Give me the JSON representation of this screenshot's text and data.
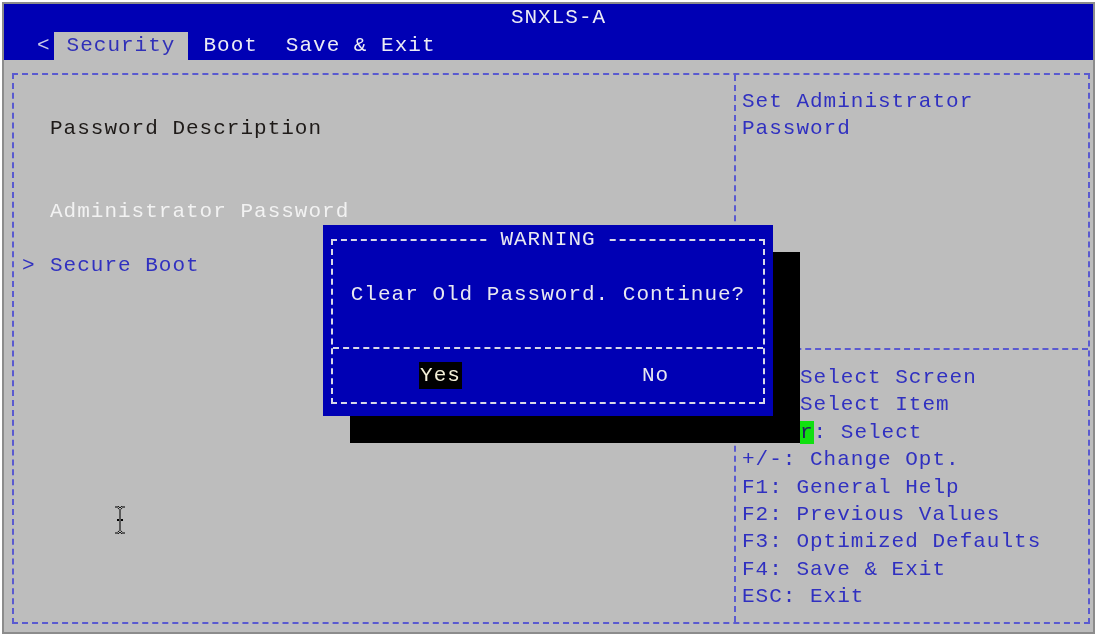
{
  "window": {
    "title": "SNXLS-A"
  },
  "tab_scroll": "<",
  "tabs": [
    {
      "label": "Security",
      "selected": true
    },
    {
      "label": "Boot",
      "selected": false
    },
    {
      "label": "Save & Exit",
      "selected": false
    }
  ],
  "items": [
    {
      "kind": "header",
      "label": "Password Description",
      "selected": false
    },
    {
      "kind": "setting",
      "label": "Administrator Password",
      "selected": true
    },
    {
      "kind": "submenu",
      "marker": ">",
      "label": "Secure Boot",
      "selected": false
    }
  ],
  "help_text": [
    "Set Administrator",
    "Password"
  ],
  "key_help": [
    {
      "kind": "covered",
      "text": "Select Screen"
    },
    {
      "kind": "covered",
      "text": "Select Item"
    },
    {
      "kind": "covered",
      "cursor": "r",
      "text": ": Select"
    },
    {
      "kind": "key",
      "text": "+/-: Change Opt."
    },
    {
      "kind": "key",
      "text": "F1: General Help"
    },
    {
      "kind": "key",
      "text": "F2: Previous Values"
    },
    {
      "kind": "key",
      "text": "F3: Optimized Defaults"
    },
    {
      "kind": "key",
      "text": "F4: Save & Exit"
    },
    {
      "kind": "key",
      "text": "ESC: Exit"
    }
  ],
  "dialog": {
    "title": "WARNING",
    "message": "Clear Old Password. Continue?",
    "buttons": [
      {
        "label": "Yes",
        "selected": true
      },
      {
        "label": "No",
        "selected": false
      }
    ]
  }
}
